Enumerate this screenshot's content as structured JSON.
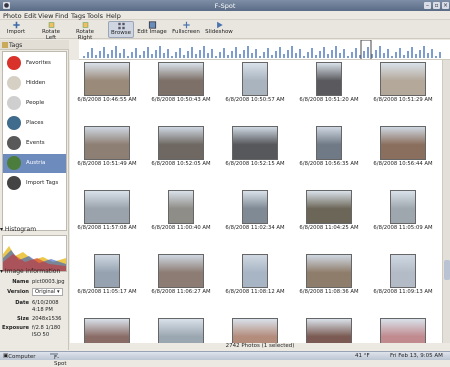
{
  "window": {
    "title": "F-Spot"
  },
  "menu": [
    "Photo",
    "Edit",
    "View",
    "Find",
    "Tags",
    "Tools",
    "Help"
  ],
  "toolbar": {
    "import": "Import",
    "rotate_left": "Rotate Left",
    "rotate_right": "Rotate Right",
    "browse": "Browse",
    "edit_image": "Edit Image",
    "fullscreen": "Fullscreen",
    "slideshow": "Slideshow"
  },
  "sidebar": {
    "tags_header": "Tags",
    "tags": [
      {
        "label": "Favorites",
        "color": "#d9322b"
      },
      {
        "label": "Hidden",
        "color": "#d6d0c4"
      },
      {
        "label": "People",
        "color": "#cfcfcf"
      },
      {
        "label": "Places",
        "color": "#3f6b8c"
      },
      {
        "label": "Events",
        "color": "#595959"
      },
      {
        "label": "Austria",
        "color": "#4c7d3c"
      },
      {
        "label": "Import Tags",
        "color": "#444444"
      }
    ],
    "histogram_header": "Histogram",
    "info_header": "Image information",
    "info": {
      "name_k": "Name",
      "name_v": "pict0003.jpg",
      "version_k": "Version",
      "version_v": "Original",
      "date_k": "Date",
      "date_v1": "6/10/2008",
      "date_v2": "4:18 PM",
      "size_k": "Size",
      "size_v": "2048x1536",
      "exposure_k": "Exposure",
      "exposure_v1": "f/2.8 1/180",
      "exposure_v2": "ISO 50"
    }
  },
  "photos": [
    {
      "cap": "6/8/2008 10:46:55 AM",
      "c": "#9a8a7a",
      "o": "l"
    },
    {
      "cap": "6/8/2008 10:50:43 AM",
      "c": "#7d7068",
      "o": "l"
    },
    {
      "cap": "6/8/2008 10:50:57 AM",
      "c": "#a9b4bf",
      "o": "p"
    },
    {
      "cap": "6/8/2008 10:51:20 AM",
      "c": "#5a5a5e",
      "o": "p"
    },
    {
      "cap": "6/8/2008 10:51:29 AM",
      "c": "#b4a89a",
      "o": "l"
    },
    {
      "cap": "6/8/2008 10:51:49 AM",
      "c": "#8e7f74",
      "o": "l"
    },
    {
      "cap": "6/8/2008 10:52:05 AM",
      "c": "#6f6862",
      "o": "l"
    },
    {
      "cap": "6/8/2008 10:52:15 AM",
      "c": "#56585c",
      "o": "l"
    },
    {
      "cap": "6/8/2008 10:56:35 AM",
      "c": "#707a86",
      "o": "p"
    },
    {
      "cap": "6/8/2008 10:56:44 AM",
      "c": "#8b6f5e",
      "o": "l"
    },
    {
      "cap": "6/8/2008 11:57:08 AM",
      "c": "#9aa3ab",
      "o": "l"
    },
    {
      "cap": "6/8/2008 11:00:40 AM",
      "c": "#8f8d87",
      "o": "p"
    },
    {
      "cap": "6/8/2008 11:02:34 AM",
      "c": "#7f8a94",
      "o": "p"
    },
    {
      "cap": "6/8/2008 11:04:25 AM",
      "c": "#6c6658",
      "o": "l"
    },
    {
      "cap": "6/8/2008 11:05:09 AM",
      "c": "#9ea7ad",
      "o": "p"
    },
    {
      "cap": "6/8/2008 11:05:17 AM",
      "c": "#96a2b0",
      "o": "p"
    },
    {
      "cap": "6/8/2008 11:06:27 AM",
      "c": "#8c7c73",
      "o": "l"
    },
    {
      "cap": "6/8/2008 11:08:12 AM",
      "c": "#a8b5c4",
      "o": "p"
    },
    {
      "cap": "6/8/2008 11:08:36 AM",
      "c": "#8f7d6b",
      "o": "l"
    },
    {
      "cap": "6/8/2008 11:09:13 AM",
      "c": "#b3bcc6",
      "o": "p"
    },
    {
      "cap": "",
      "c": "#8a6c66",
      "o": "l"
    },
    {
      "cap": "",
      "c": "#9aa6b0",
      "o": "l"
    },
    {
      "cap": "",
      "c": "#b48c7c",
      "o": "l"
    },
    {
      "cap": "",
      "c": "#7a5a52",
      "o": "l"
    },
    {
      "cap": "",
      "c": "#c08a8e",
      "o": "l"
    }
  ],
  "status": "2742 Photos (1 selected)",
  "taskbar": {
    "computer": "Computer",
    "app": "F-Spot",
    "temp": "41 °F",
    "datetime": "Fri Feb 13,  9:05 AM"
  }
}
